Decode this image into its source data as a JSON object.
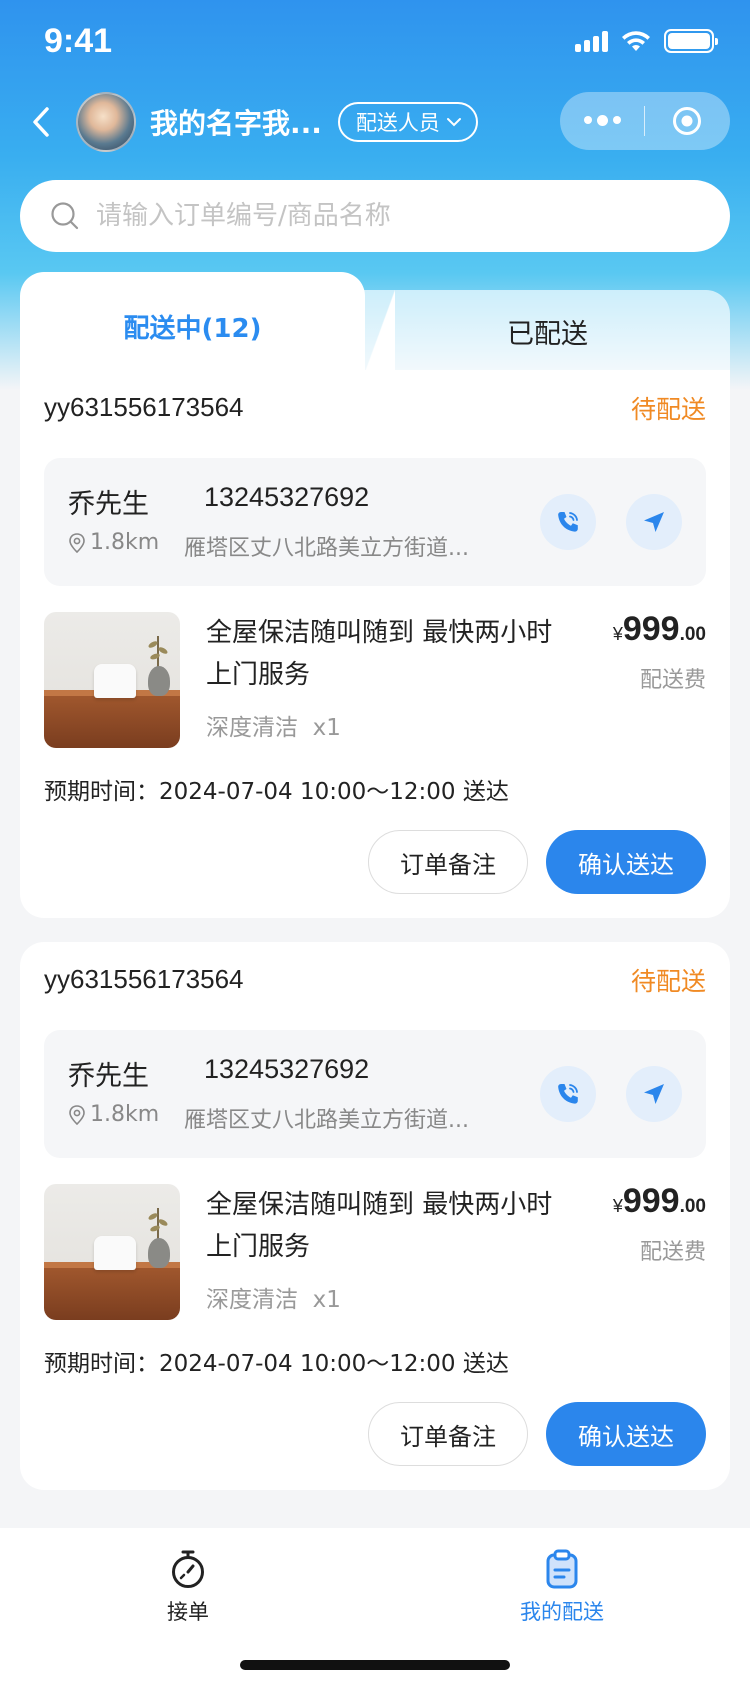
{
  "status_bar": {
    "time": "9:41"
  },
  "header": {
    "username": "我的名字我...",
    "role_label": "配送人员",
    "avatar": "user-avatar"
  },
  "search": {
    "placeholder": "请输入订单编号/商品名称"
  },
  "tabs": [
    {
      "label": "配送中(12)",
      "active": true
    },
    {
      "label": "已配送",
      "active": false
    }
  ],
  "orders": [
    {
      "order_no": "yy631556173564",
      "status": "待配送",
      "customer_name": "乔先生",
      "phone": "13245327692",
      "distance": "1.8km",
      "address": "雁塔区丈八北路美立方街道...",
      "product_title": "全屋保洁随叫随到 最快两小时上门服务",
      "spec": "深度清洁",
      "qty": "x1",
      "currency": "¥",
      "price_int": "999",
      "price_dec": ".00",
      "fee_label": "配送费",
      "eta": "预期时间：2024-07-04 10:00～12:00 送达",
      "note_button": "订单备注",
      "confirm_button": "确认送达"
    },
    {
      "order_no": "yy631556173564",
      "status": "待配送",
      "customer_name": "乔先生",
      "phone": "13245327692",
      "distance": "1.8km",
      "address": "雁塔区丈八北路美立方街道...",
      "product_title": "全屋保洁随叫随到 最快两小时上门服务",
      "spec": "深度清洁",
      "qty": "x1",
      "currency": "¥",
      "price_int": "999",
      "price_dec": ".00",
      "fee_label": "配送费",
      "eta": "预期时间：2024-07-04 10:00～12:00 送达",
      "note_button": "订单备注",
      "confirm_button": "确认送达"
    }
  ],
  "tabbar": [
    {
      "label": "接单",
      "icon": "stopwatch-icon",
      "active": false
    },
    {
      "label": "我的配送",
      "icon": "clipboard-icon",
      "active": true
    }
  ],
  "colors": {
    "accent": "#2b86ec",
    "status_pending": "#f08a24"
  }
}
